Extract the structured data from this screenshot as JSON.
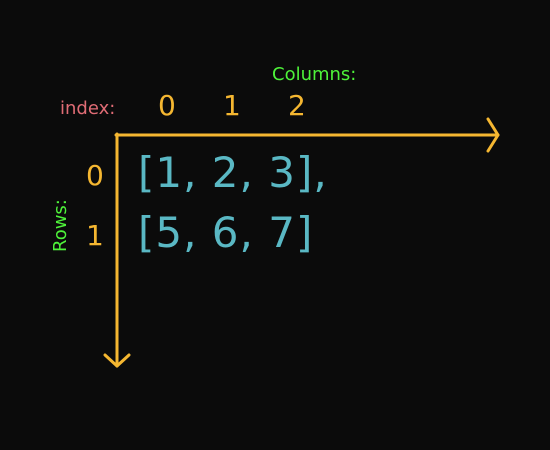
{
  "labels": {
    "index": "index:",
    "columns": "Columns:",
    "rows": "Rows:"
  },
  "column_indices": [
    "0",
    "1",
    "2"
  ],
  "row_indices": [
    "0",
    "1"
  ],
  "array_rows": [
    "[1,  2,  3],",
    "[5,  6,  7]"
  ],
  "colors": {
    "background": "#0b0b0b",
    "index_label": "#e06c75",
    "axis_label": "#4ef33a",
    "index_numbers": "#f5b731",
    "array_text": "#5ab8c4",
    "arrows": "#f5b731"
  }
}
